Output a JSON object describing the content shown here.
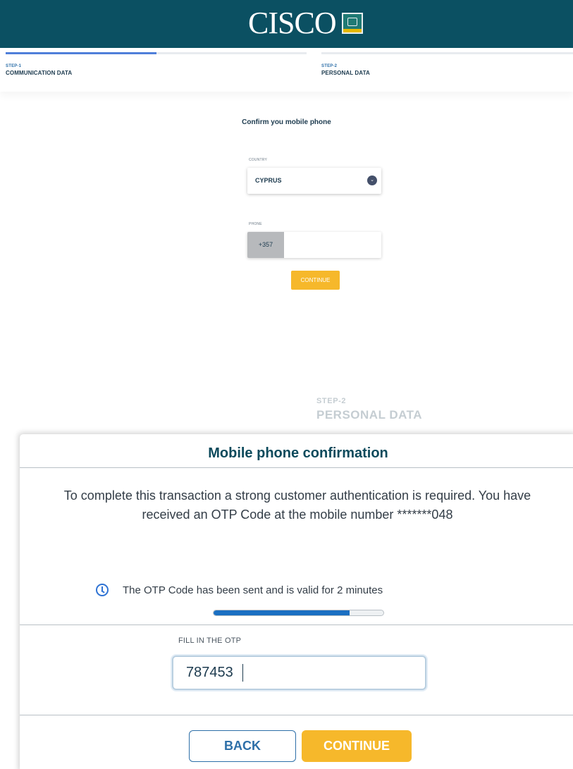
{
  "header": {
    "logo_text": "CISCO",
    "logo_badge_icon": "bank-emblem-icon"
  },
  "steps": [
    {
      "number": "STEP-1",
      "title": "COMMUNICATION DATA",
      "progress": 0.5
    },
    {
      "number": "STEP-2",
      "title": "PERSONAL DATA",
      "progress": 0
    }
  ],
  "form": {
    "title": "Confirm you mobile phone",
    "country_label": "COUNTRY",
    "country_value": "CYPRUS",
    "phone_label": "PHONE",
    "phone_prefix": "+357",
    "phone_value": "",
    "continue_label": "CONTINUE"
  },
  "ghost_step": {
    "number": "STEP-2",
    "title": "PERSONAL DATA"
  },
  "modal": {
    "title": "Mobile phone confirmation",
    "message": "To complete this transaction a strong customer authentication is required. You have received an OTP Code at the mobile number *******048",
    "otp_info": "The OTP Code has been sent and is valid for 2 minutes",
    "otp_timer_remaining": 0.8,
    "otp_label": "FILL IN THE OTP",
    "otp_value": "787453",
    "back_label": "BACK",
    "continue_label": "CONTINUE"
  },
  "colors": {
    "header_bg": "#0b5062",
    "accent_yellow": "#f6b82b",
    "accent_blue": "#2d6fa8"
  }
}
